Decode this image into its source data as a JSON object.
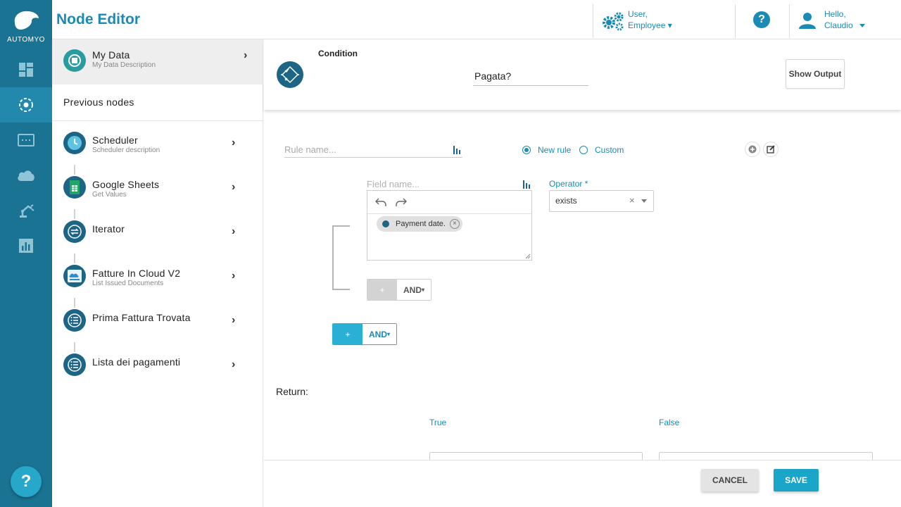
{
  "brand": {
    "name": "AUTOMYO",
    "accent": "#1a8bb5",
    "rail_color": "#1a7393"
  },
  "header": {
    "title": "Node Editor",
    "role_line1": "User,",
    "role_line2": "Employee",
    "greeting": "Hello,",
    "user_name": "Claudio"
  },
  "rail": {
    "items": [
      "dashboard-icon",
      "nodes-icon",
      "terminal-icon",
      "cloud-icon",
      "robot-arm-icon",
      "chart-icon"
    ],
    "active_index": 1,
    "help": "?"
  },
  "panel": {
    "my_data": {
      "title": "My Data",
      "subtitle": "My Data Description"
    },
    "previous_title": "Previous nodes",
    "nodes": [
      {
        "title": "Scheduler",
        "subtitle": "Scheduler description",
        "icon": "clock-icon"
      },
      {
        "title": "Google Sheets",
        "subtitle": "Get Values",
        "icon": "sheets-icon"
      },
      {
        "title": "Iterator",
        "subtitle": "",
        "icon": "loop-icon"
      },
      {
        "title": "Fatture In Cloud V2",
        "subtitle": "List Issued Documents",
        "icon": "cloud-doc-icon"
      },
      {
        "title": "Prima Fattura Trovata",
        "subtitle": "",
        "icon": "list-icon"
      },
      {
        "title": "Lista dei pagamenti",
        "subtitle": "",
        "icon": "list-icon"
      }
    ]
  },
  "condition": {
    "label": "Condition",
    "name": "Pagata?",
    "show_output": "Show Output"
  },
  "rule": {
    "name_placeholder": "Rule name...",
    "new_rule": "New rule",
    "custom": "Custom",
    "field_placeholder": "Field name...",
    "chip": "Payment date.",
    "operator_label": "Operator *",
    "operator_value": "exists",
    "inner_plus": "+",
    "inner_and": "AND",
    "outer_plus": "+",
    "outer_and": "AND"
  },
  "return": {
    "label": "Return:",
    "true_label": "True",
    "false_label": "False"
  },
  "footer": {
    "cancel": "CANCEL",
    "save": "SAVE"
  }
}
